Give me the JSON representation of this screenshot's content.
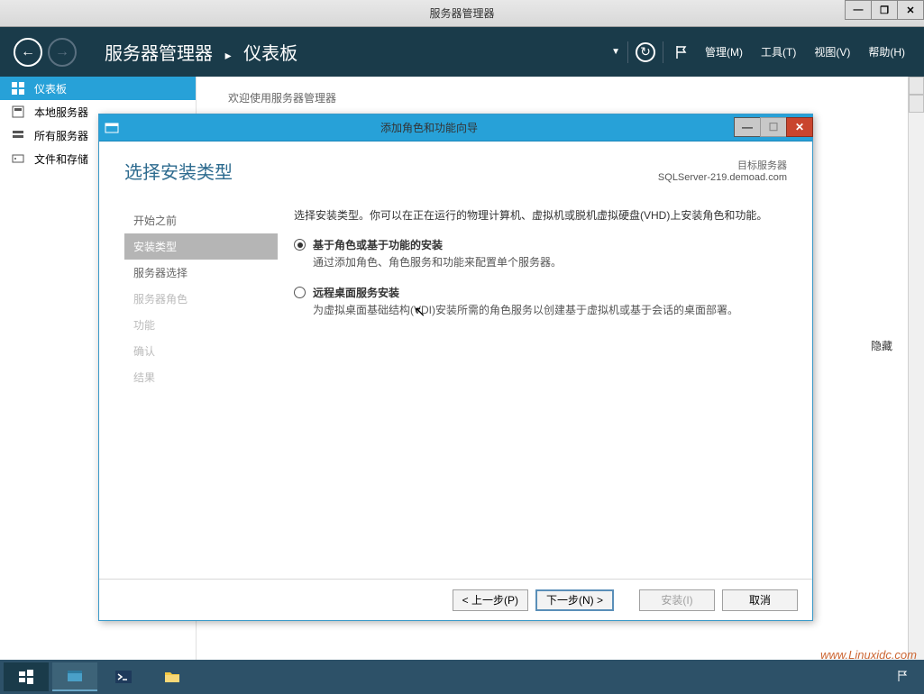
{
  "outer_window": {
    "title": "服务器管理器"
  },
  "header": {
    "app_name": "服务器管理器",
    "breadcrumb": "仪表板",
    "menu": {
      "manage": "管理(M)",
      "tools": "工具(T)",
      "view": "视图(V)",
      "help": "帮助(H)"
    }
  },
  "sidebar": {
    "items": [
      {
        "label": "仪表板"
      },
      {
        "label": "本地服务器"
      },
      {
        "label": "所有服务器"
      },
      {
        "label": "文件和存储"
      }
    ]
  },
  "main": {
    "welcome": "欢迎使用服务器管理器",
    "hide": "隐藏"
  },
  "wizard": {
    "title": "添加角色和功能向导",
    "heading": "选择安装类型",
    "target_label": "目标服务器",
    "target_server": "SQLServer-219.demoad.com",
    "steps": [
      {
        "label": "开始之前",
        "state": "done"
      },
      {
        "label": "安装类型",
        "state": "active"
      },
      {
        "label": "服务器选择",
        "state": "done"
      },
      {
        "label": "服务器角色",
        "state": "disabled"
      },
      {
        "label": "功能",
        "state": "disabled"
      },
      {
        "label": "确认",
        "state": "disabled"
      },
      {
        "label": "结果",
        "state": "disabled"
      }
    ],
    "intro": "选择安装类型。你可以在正在运行的物理计算机、虚拟机或脱机虚拟硬盘(VHD)上安装角色和功能。",
    "options": [
      {
        "title": "基于角色或基于功能的安装",
        "desc": "通过添加角色、角色服务和功能来配置单个服务器。",
        "selected": true
      },
      {
        "title": "远程桌面服务安装",
        "desc": "为虚拟桌面基础结构(VDI)安装所需的角色服务以创建基于虚拟机或基于会话的桌面部署。",
        "selected": false
      }
    ],
    "buttons": {
      "prev": "< 上一步(P)",
      "next": "下一步(N) >",
      "install": "安装(I)",
      "cancel": "取消"
    }
  },
  "watermark": "www.Linuxidc.com"
}
